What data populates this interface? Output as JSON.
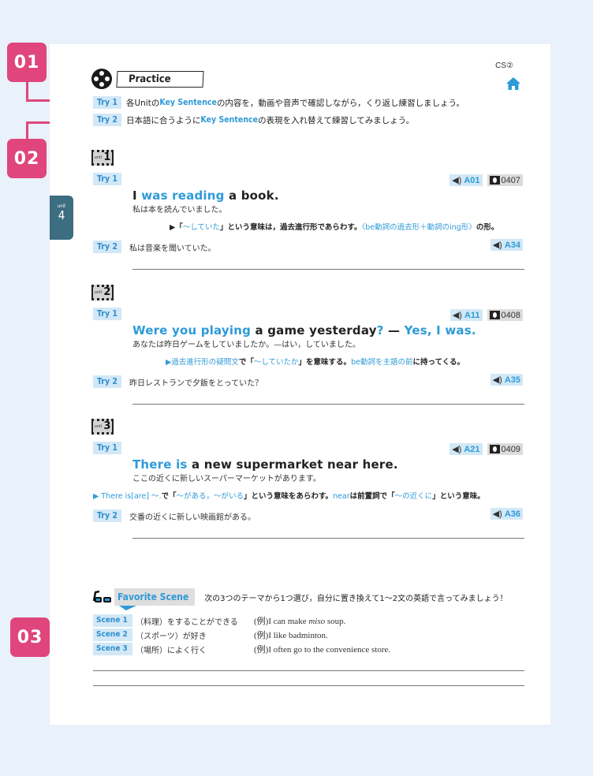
{
  "callouts": [
    "01",
    "02",
    "03"
  ],
  "unit_tab": {
    "label": "unit",
    "number": "4"
  },
  "header": {
    "cs_label": "CS②",
    "practice_title": "Practice",
    "home_icon": "home-icon",
    "reel_icon": "film-reel-icon"
  },
  "intro": [
    {
      "tag": "Try 1",
      "pre": "各Unitの",
      "key": "Key Sentence",
      "post": "の内容を，動画や音声で確認しながら，くり返し練習しましょう。"
    },
    {
      "tag": "Try 2",
      "pre": "日本語に合うように",
      "key": "Key Sentence",
      "post": "の表現を入れ替えて練習してみましょう。"
    }
  ],
  "units": [
    {
      "unit_label": "unit",
      "unit_number": "1",
      "try1_tag": "Try 1",
      "audio_code": "A01",
      "video_code": "0407",
      "sentence": [
        {
          "text": "I ",
          "hl": false
        },
        {
          "text": "was reading",
          "hl": true
        },
        {
          "text": " a book.",
          "hl": false
        }
      ],
      "translation": "私は本を読んでいました。",
      "note": [
        {
          "text": "▶「",
          "hl": false
        },
        {
          "text": "～していた",
          "hl": true
        },
        {
          "text": "」という意味は，過去進行形であらわす。",
          "hl": false
        },
        {
          "text": "〈be動詞の過去形＋動詞のing形〉",
          "hl": true
        },
        {
          "text": "の形。",
          "hl": false
        }
      ],
      "try2_tag": "Try 2",
      "try2_text": "私は音楽を聞いていた。",
      "try2_audio": "A34"
    },
    {
      "unit_label": "unit",
      "unit_number": "2",
      "try1_tag": "Try 1",
      "audio_code": "A11",
      "video_code": "0408",
      "sentence": [
        {
          "text": "Were you playing",
          "hl": true
        },
        {
          "text": " a game yesterday",
          "hl": false
        },
        {
          "text": "?",
          "hl": true
        },
        {
          "text": " — ",
          "hl": false
        },
        {
          "text": "Yes, I was.",
          "hl": true
        }
      ],
      "translation": "あなたは昨日ゲームをしていましたか。—はい，していました。",
      "note": [
        {
          "text": "▶過去進行形の疑問文",
          "hl": true
        },
        {
          "text": "で「",
          "hl": false
        },
        {
          "text": "～していたか",
          "hl": true
        },
        {
          "text": "」を意味する。",
          "hl": false
        },
        {
          "text": "be動詞を主語の前",
          "hl": true
        },
        {
          "text": "に持ってくる。",
          "hl": false
        }
      ],
      "try2_tag": "Try 2",
      "try2_text": "昨日レストランで夕飯をとっていた？",
      "try2_audio": "A35"
    },
    {
      "unit_label": "unit",
      "unit_number": "3",
      "try1_tag": "Try 1",
      "audio_code": "A21",
      "video_code": "0409",
      "sentence": [
        {
          "text": "There is",
          "hl": true
        },
        {
          "text": " a new supermarket near here.",
          "hl": false
        }
      ],
      "translation": "ここの近くに新しいスーパーマーケットがあります。",
      "note": [
        {
          "text": "▶ There is[are] ～.",
          "hl": true
        },
        {
          "text": "で「",
          "hl": false
        },
        {
          "text": "～がある，～がいる",
          "hl": true
        },
        {
          "text": "」という意味をあらわす。",
          "hl": false
        },
        {
          "text": "near",
          "hl": true
        },
        {
          "text": "は前置詞で「",
          "hl": false
        },
        {
          "text": "～の近くに",
          "hl": true
        },
        {
          "text": "」という意味。",
          "hl": false
        }
      ],
      "try2_tag": "Try 2",
      "try2_text": "交番の近くに新しい映画館がある。",
      "try2_audio": "A36"
    }
  ],
  "favorite": {
    "title": "Favorite Scene",
    "icon": "3d-glasses-icon",
    "description": "次の3つのテーマから1つ選び，自分に置き換えて1～2文の英語で言ってみましょう！",
    "scenes": [
      {
        "tag": "Scene 1",
        "theme": "（料理）をすることができる",
        "example_pre": "(例)I can make ",
        "example_em": "miso",
        "example_post": " soup."
      },
      {
        "tag": "Scene 2",
        "theme": "（スポーツ）が好き",
        "example_pre": "(例)I like badminton.",
        "example_em": "",
        "example_post": ""
      },
      {
        "tag": "Scene 3",
        "theme": "（場所）によく行く",
        "example_pre": "(例)I often go to the convenience store.",
        "example_em": "",
        "example_post": ""
      }
    ]
  },
  "colors": {
    "accent_pink": "#e0457b",
    "accent_blue": "#2e9ad8",
    "tag_bg": "#d2e8f6",
    "unit_tab": "#3c6d80",
    "page_bg": "#e9f1fa"
  }
}
